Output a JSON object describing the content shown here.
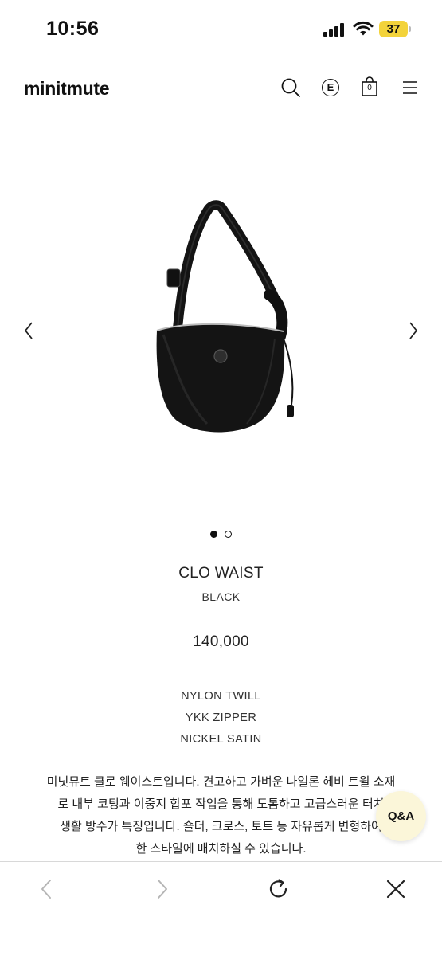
{
  "status_bar": {
    "time": "10:56",
    "battery": "37",
    "battery_color": "#f3d33b"
  },
  "header": {
    "logo": "minitmute",
    "icons": [
      "search-icon",
      "e-circle-icon",
      "shopping-bag-icon",
      "menu-icon"
    ],
    "e_icon_label": "E",
    "bag_count": "0"
  },
  "gallery": {
    "image_description_icon": "black-crescent-bag-image",
    "prev_icon": "chevron-left-icon",
    "next_icon": "chevron-right-icon",
    "slide_count": 2,
    "active_slide": 1
  },
  "product": {
    "name": "CLO WAIST",
    "color": "BLACK",
    "price": "140,000",
    "specs": [
      "NYLON TWILL",
      "YKK ZIPPER",
      "NICKEL SATIN"
    ],
    "description_lines": [
      "미닛뮤트 클로 웨이스트입니다. 견고하고 가벼운 나일론 헤비 트윌 소재",
      "로 내부 코팅과 이중지 합포 작업을 통해 도톰하고 고급스러운 터치",
      "생활 방수가 특징입니다. 숄더, 크로스, 토트 등 자유롭게 변형하여",
      "한 스타일에 매치하실 수 있습니다."
    ]
  },
  "qa_button": {
    "label": "Q&A",
    "bg_color": "#fbf6d9"
  },
  "browser_toolbar": {
    "icons": [
      "back-arrow-icon",
      "forward-arrow-icon",
      "reload-icon",
      "close-icon"
    ]
  }
}
